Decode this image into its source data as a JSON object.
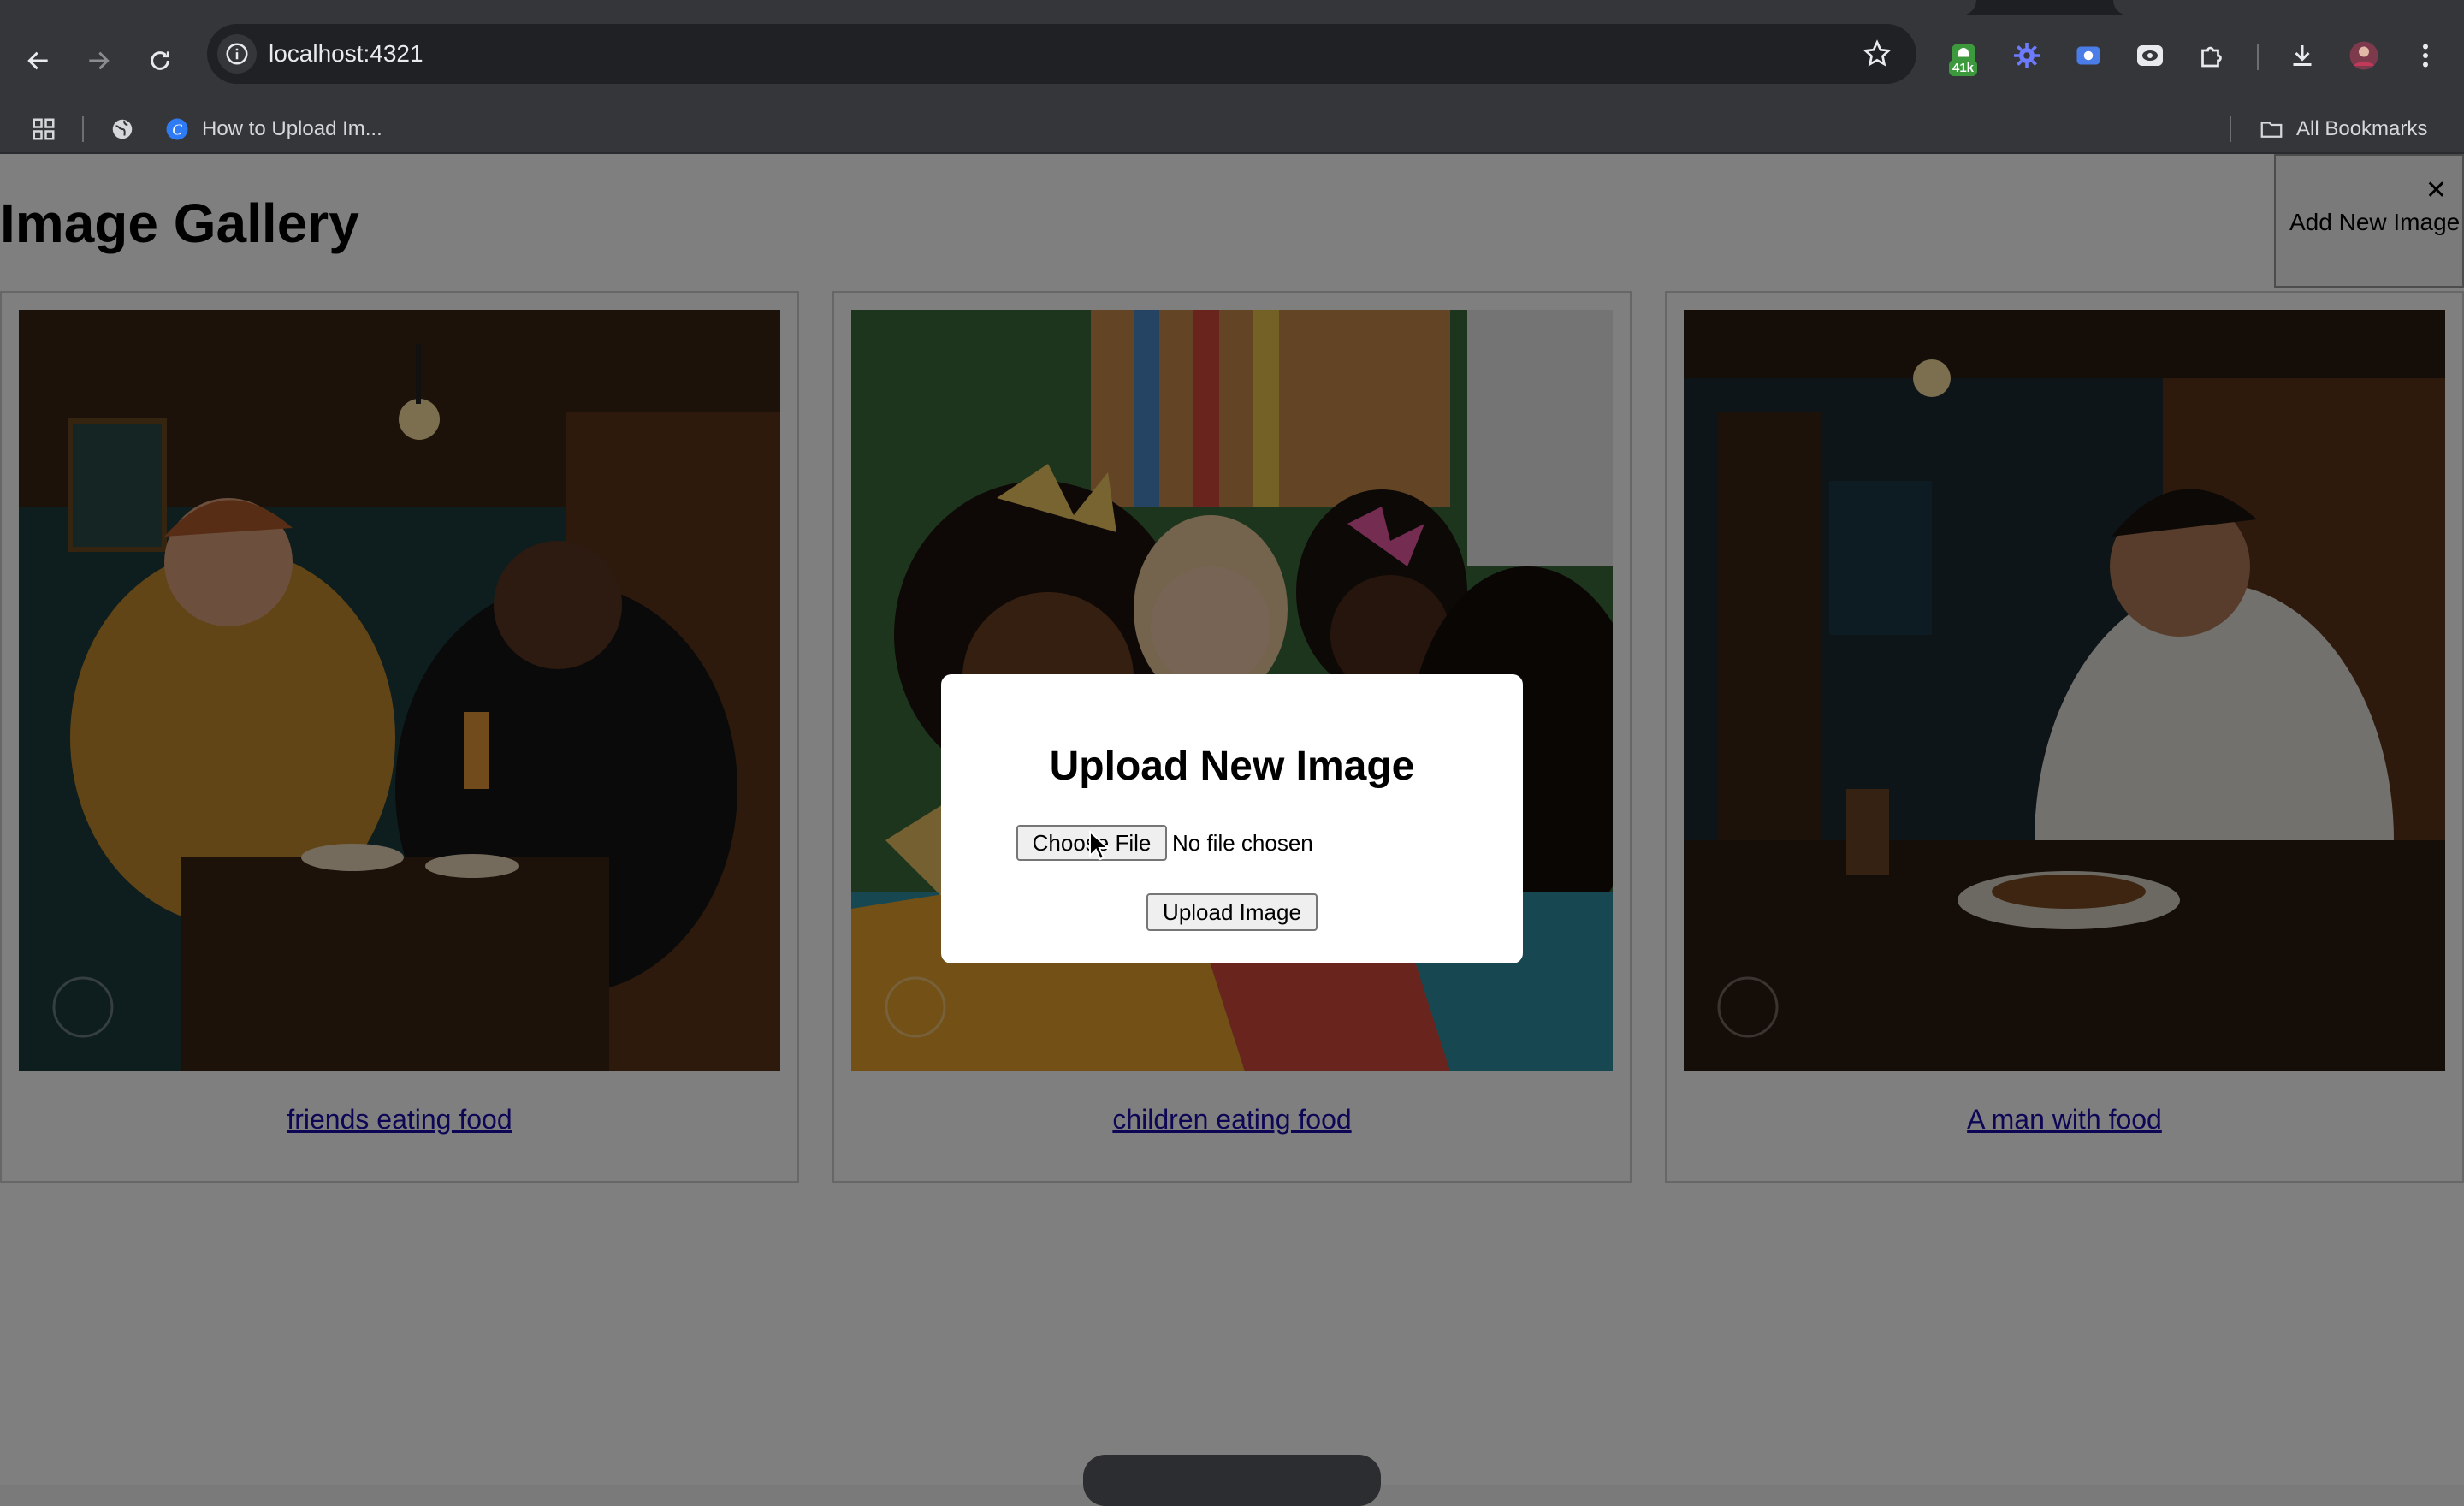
{
  "browser": {
    "url": "localhost:4321",
    "extension_badge": "41k",
    "bookmarks": [
      {
        "label": "How to Upload Im..."
      }
    ],
    "all_bookmarks_label": "All Bookmarks"
  },
  "page": {
    "title": "Image Gallery",
    "add_button_label": "Add New Image",
    "close_glyph": "✕"
  },
  "gallery": [
    {
      "caption": "friends eating food"
    },
    {
      "caption": "children eating food"
    },
    {
      "caption": "A man with food"
    }
  ],
  "modal": {
    "title": "Upload New Image",
    "choose_file_label": "Choose File",
    "file_status": "No file chosen",
    "submit_label": "Upload Image"
  }
}
